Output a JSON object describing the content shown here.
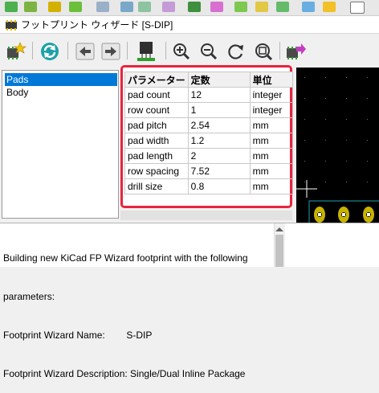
{
  "window": {
    "title": "フットプリント ウィザード [S-DIP]"
  },
  "toolbar": {
    "buttons": [
      {
        "name": "select-wizard-button",
        "icon": "wizard-star-icon"
      },
      {
        "name": "refresh-button",
        "icon": "refresh-icon"
      },
      {
        "name": "previous-button",
        "icon": "arrow-left-icon"
      },
      {
        "name": "next-button",
        "icon": "arrow-right-icon"
      },
      {
        "name": "show-3d-button",
        "icon": "chip-icon"
      },
      {
        "name": "zoom-in-button",
        "icon": "zoom-in-icon"
      },
      {
        "name": "zoom-out-button",
        "icon": "zoom-out-icon"
      },
      {
        "name": "redraw-button",
        "icon": "redraw-icon"
      },
      {
        "name": "zoom-fit-button",
        "icon": "zoom-fit-icon"
      },
      {
        "name": "export-footprint-button",
        "icon": "export-icon"
      }
    ]
  },
  "pages": {
    "items": [
      "Pads",
      "Body"
    ],
    "selected": "Pads"
  },
  "grid": {
    "headers": [
      "パラメーター",
      "定数",
      "単位"
    ],
    "rows": [
      [
        "pad count",
        "12",
        "integer"
      ],
      [
        "row count",
        "1",
        "integer"
      ],
      [
        "pad pitch",
        "2.54",
        "mm"
      ],
      [
        "pad width",
        "1.2",
        "mm"
      ],
      [
        "pad length",
        "2",
        "mm"
      ],
      [
        "row spacing",
        "7.52",
        "mm"
      ],
      [
        "drill size",
        "0.8",
        "mm"
      ]
    ],
    "highlight_color": "#e8243f"
  },
  "messages": {
    "line1": "Building new KiCad FP Wizard footprint with the following",
    "line2": "parameters:",
    "line3": "Footprint Wizard Name:        S-DIP",
    "line4": "Footprint Wizard Description: Single/Dual Inline Package"
  },
  "preview": {
    "background": "#000000",
    "pad_color": "#c8b400"
  }
}
